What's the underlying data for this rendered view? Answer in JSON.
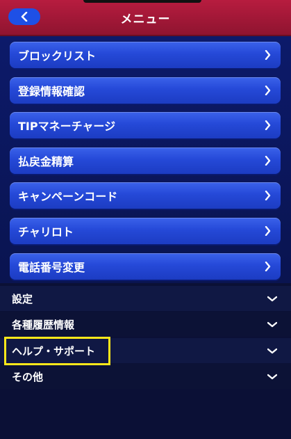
{
  "header": {
    "title": "メニュー"
  },
  "menu_items": [
    {
      "label": "ブロックリスト"
    },
    {
      "label": "登録情報確認"
    },
    {
      "label": "TIPマネーチャージ"
    },
    {
      "label": "払戻金精算"
    },
    {
      "label": "キャンペーンコード"
    },
    {
      "label": "チャリロト"
    },
    {
      "label": "電話番号変更"
    }
  ],
  "sections": [
    {
      "label": "設定"
    },
    {
      "label": "各種履歴情報"
    },
    {
      "label": "ヘルプ・サポート"
    },
    {
      "label": "その他"
    }
  ],
  "colors": {
    "header": "#a8183a",
    "button": "#2549d8",
    "highlight": "#ffe81a",
    "background": "#0b1036"
  },
  "icons": {
    "back": "chevron-left-icon",
    "item": "chevron-right-icon",
    "section": "chevron-down-icon"
  }
}
